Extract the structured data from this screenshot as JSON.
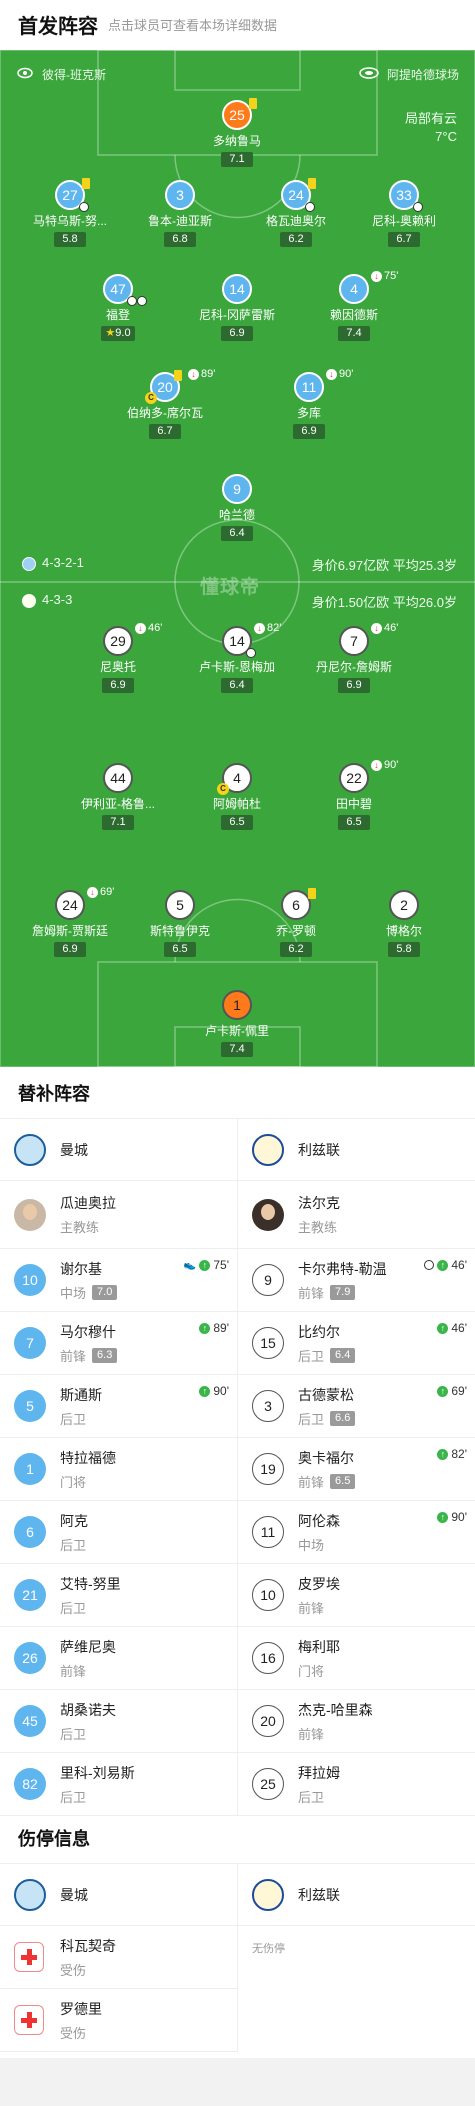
{
  "header": {
    "title": "首发阵容",
    "subtitle": "点击球员可查看本场详细数据"
  },
  "pitch": {
    "referee": "彼得-班克斯",
    "stadium": "阿提哈德球场",
    "weather": "局部有云",
    "temperature": "7°C",
    "watermark": "懂球帝",
    "home": {
      "formation": "4-3-2-1",
      "value": "身价6.97亿欧  平均25.3岁"
    },
    "away": {
      "formation": "4-3-3",
      "value": "身价1.50亿欧  平均26.0岁"
    }
  },
  "home_players": [
    {
      "num": "25",
      "name": "多纳鲁马",
      "rating": "7.1"
    },
    {
      "num": "27",
      "name": "马特乌斯-努...",
      "rating": "5.8"
    },
    {
      "num": "3",
      "name": "鲁本-迪亚斯",
      "rating": "6.8"
    },
    {
      "num": "24",
      "name": "格瓦迪奥尔",
      "rating": "6.2"
    },
    {
      "num": "33",
      "name": "尼科-奥赖利",
      "rating": "6.7"
    },
    {
      "num": "47",
      "name": "福登",
      "rating": "9.0"
    },
    {
      "num": "14",
      "name": "尼科-冈萨雷斯",
      "rating": "6.9"
    },
    {
      "num": "4",
      "name": "赖因德斯",
      "rating": "7.4",
      "sub": "75'"
    },
    {
      "num": "20",
      "name": "伯纳多-席尔瓦",
      "rating": "6.7",
      "sub": "89'"
    },
    {
      "num": "11",
      "name": "多库",
      "rating": "6.9",
      "sub": "90'"
    },
    {
      "num": "9",
      "name": "哈兰德",
      "rating": "6.4"
    }
  ],
  "away_players": [
    {
      "num": "29",
      "name": "尼奥托",
      "rating": "6.9",
      "sub": "46'"
    },
    {
      "num": "14",
      "name": "卢卡斯-恩梅加",
      "rating": "6.4",
      "sub": "82'"
    },
    {
      "num": "7",
      "name": "丹尼尔-詹姆斯",
      "rating": "6.9",
      "sub": "46'"
    },
    {
      "num": "44",
      "name": "伊利亚-格鲁...",
      "rating": "7.1"
    },
    {
      "num": "4",
      "name": "阿姆帕杜",
      "rating": "6.5"
    },
    {
      "num": "22",
      "name": "田中碧",
      "rating": "6.5",
      "sub": "90'"
    },
    {
      "num": "24",
      "name": "詹姆斯-贾斯廷",
      "rating": "6.9",
      "sub": "69'"
    },
    {
      "num": "5",
      "name": "斯特鲁伊克",
      "rating": "6.5"
    },
    {
      "num": "6",
      "name": "乔-罗顿",
      "rating": "6.2"
    },
    {
      "num": "2",
      "name": "博格尔",
      "rating": "5.8"
    },
    {
      "num": "1",
      "name": "卢卡斯-佩里",
      "rating": "7.4"
    }
  ],
  "subs": {
    "title": "替补阵容",
    "home_team": "曼城",
    "away_team": "利兹联",
    "home_coach": {
      "name": "瓜迪奥拉",
      "role": "主教练"
    },
    "away_coach": {
      "name": "法尔克",
      "role": "主教练"
    },
    "home": [
      {
        "num": "10",
        "name": "谢尔基",
        "pos": "中场",
        "rating": "7.0",
        "in": "75'"
      },
      {
        "num": "7",
        "name": "马尔穆什",
        "pos": "前锋",
        "rating": "6.3",
        "in": "89'"
      },
      {
        "num": "5",
        "name": "斯通斯",
        "pos": "后卫",
        "in": "90'"
      },
      {
        "num": "1",
        "name": "特拉福德",
        "pos": "门将"
      },
      {
        "num": "6",
        "name": "阿克",
        "pos": "后卫"
      },
      {
        "num": "21",
        "name": "艾特-努里",
        "pos": "后卫"
      },
      {
        "num": "26",
        "name": "萨维尼奥",
        "pos": "前锋"
      },
      {
        "num": "45",
        "name": "胡桑诺夫",
        "pos": "后卫"
      },
      {
        "num": "82",
        "name": "里科-刘易斯",
        "pos": "后卫"
      }
    ],
    "away": [
      {
        "num": "9",
        "name": "卡尔弗特-勒温",
        "pos": "前锋",
        "rating": "7.9",
        "in": "46'"
      },
      {
        "num": "15",
        "name": "比约尔",
        "pos": "后卫",
        "rating": "6.4",
        "in": "46'"
      },
      {
        "num": "3",
        "name": "古德蒙松",
        "pos": "后卫",
        "rating": "6.6",
        "in": "69'"
      },
      {
        "num": "19",
        "name": "奥卡福尔",
        "pos": "前锋",
        "rating": "6.5",
        "in": "82'"
      },
      {
        "num": "11",
        "name": "阿伦森",
        "pos": "中场",
        "in": "90'"
      },
      {
        "num": "10",
        "name": "皮罗埃",
        "pos": "前锋"
      },
      {
        "num": "16",
        "name": "梅利耶",
        "pos": "门将"
      },
      {
        "num": "20",
        "name": "杰克-哈里森",
        "pos": "前锋"
      },
      {
        "num": "25",
        "name": "拜拉姆",
        "pos": "后卫"
      }
    ]
  },
  "injuries": {
    "title": "伤停信息",
    "home_team": "曼城",
    "away_team": "利兹联",
    "home": [
      {
        "name": "科瓦契奇",
        "status": "受伤"
      },
      {
        "name": "罗德里",
        "status": "受伤"
      }
    ],
    "away_none": "无伤停"
  }
}
